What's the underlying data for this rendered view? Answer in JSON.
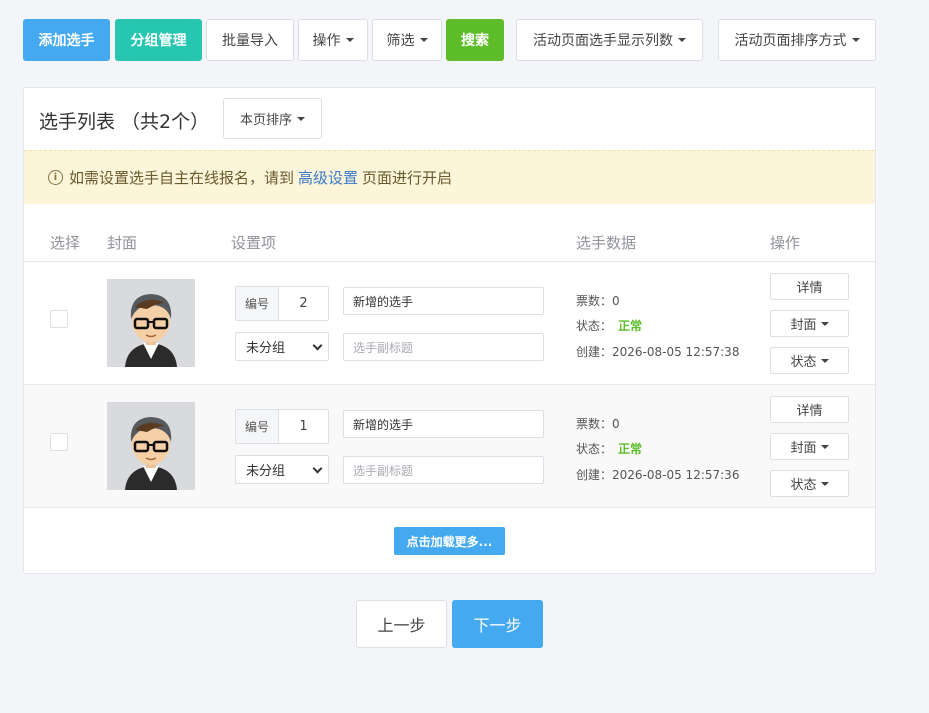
{
  "toolbar": {
    "add_player": "添加选手",
    "group_manage": "分组管理",
    "batch_import": "批量导入",
    "operate": "操作",
    "filter": "筛选",
    "search": "搜索",
    "columns": "活动页面选手显示列数",
    "sort": "活动页面排序方式"
  },
  "panel": {
    "title": "选手列表 （共2个）",
    "page_sort": "本页排序",
    "notice_prefix": "如需设置选手自主在线报名，请到",
    "notice_link": "高级设置",
    "notice_suffix": "页面进行开启",
    "columns": {
      "select": "选择",
      "cover": "封面",
      "settings": "设置项",
      "data": "选手数据",
      "ops": "操作"
    }
  },
  "rows": [
    {
      "num_label": "编号",
      "number": "2",
      "name": "新增的选手",
      "group": "未分组",
      "subtitle_placeholder": "选手副标题",
      "votes": "票数：0",
      "status_label": "状态：",
      "status_value": "正常",
      "created": "创建：2026-08-05 12:57:38",
      "btn_detail": "详情",
      "btn_cover": "封面",
      "btn_status": "状态"
    },
    {
      "num_label": "编号",
      "number": "1",
      "name": "新增的选手",
      "group": "未分组",
      "subtitle_placeholder": "选手副标题",
      "votes": "票数：0",
      "status_label": "状态：",
      "status_value": "正常",
      "created": "创建：2026-08-05 12:57:36",
      "btn_detail": "详情",
      "btn_cover": "封面",
      "btn_status": "状态"
    }
  ],
  "load_more": "点击加载更多...",
  "nav": {
    "prev": "上一步",
    "next": "下一步"
  },
  "colors": {
    "primary": "#45a9f0",
    "teal": "#26c6b0",
    "green": "#5cbd29",
    "notice_bg": "#fcf5da",
    "page_bg": "#f4f5f9"
  }
}
